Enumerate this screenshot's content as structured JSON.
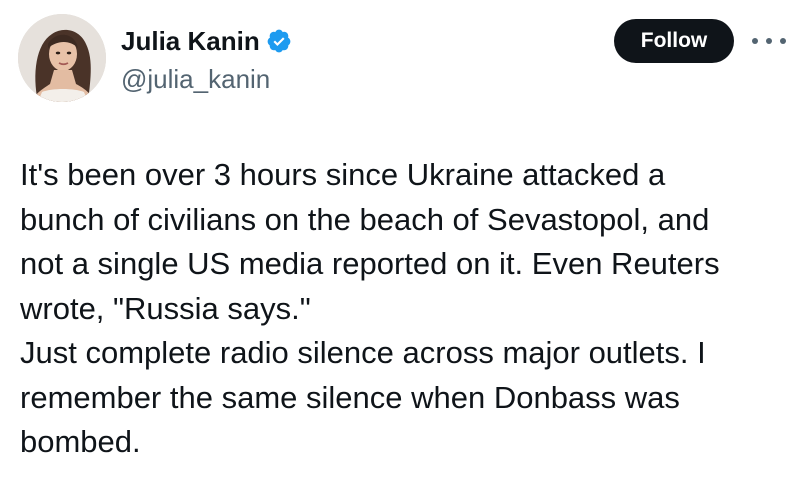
{
  "author": {
    "display_name": "Julia Kanin",
    "handle": "@julia_kanin",
    "verified": true,
    "verified_icon": "verified-badge-icon",
    "avatar": "avatar-photo"
  },
  "actions": {
    "follow_label": "Follow",
    "more_icon": "more-options-icon"
  },
  "tweet": {
    "text": "It's been over 3 hours since Ukraine attacked a\nbunch of civilians on the beach of Sevastopol, and\nnot a single US media reported on it. Even Reuters\nwrote, \"Russia says.\"\nJust complete radio silence across major outlets. I\nremember the same silence when Donbass was\nbombed."
  },
  "colors": {
    "text_primary": "#0f1419",
    "text_secondary": "#536471",
    "verified_blue": "#1d9bf0",
    "follow_bg": "#0f1419"
  }
}
